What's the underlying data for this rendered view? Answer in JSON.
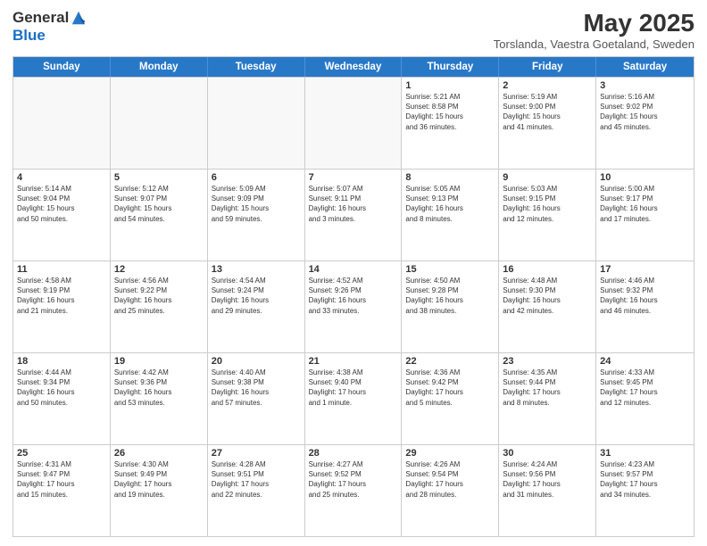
{
  "logo": {
    "general": "General",
    "blue": "Blue"
  },
  "title": "May 2025",
  "subtitle": "Torslanda, Vaestra Goetaland, Sweden",
  "header_days": [
    "Sunday",
    "Monday",
    "Tuesday",
    "Wednesday",
    "Thursday",
    "Friday",
    "Saturday"
  ],
  "weeks": [
    [
      {
        "day": "",
        "info": ""
      },
      {
        "day": "",
        "info": ""
      },
      {
        "day": "",
        "info": ""
      },
      {
        "day": "",
        "info": ""
      },
      {
        "day": "1",
        "info": "Sunrise: 5:21 AM\nSunset: 8:58 PM\nDaylight: 15 hours\nand 36 minutes."
      },
      {
        "day": "2",
        "info": "Sunrise: 5:19 AM\nSunset: 9:00 PM\nDaylight: 15 hours\nand 41 minutes."
      },
      {
        "day": "3",
        "info": "Sunrise: 5:16 AM\nSunset: 9:02 PM\nDaylight: 15 hours\nand 45 minutes."
      }
    ],
    [
      {
        "day": "4",
        "info": "Sunrise: 5:14 AM\nSunset: 9:04 PM\nDaylight: 15 hours\nand 50 minutes."
      },
      {
        "day": "5",
        "info": "Sunrise: 5:12 AM\nSunset: 9:07 PM\nDaylight: 15 hours\nand 54 minutes."
      },
      {
        "day": "6",
        "info": "Sunrise: 5:09 AM\nSunset: 9:09 PM\nDaylight: 15 hours\nand 59 minutes."
      },
      {
        "day": "7",
        "info": "Sunrise: 5:07 AM\nSunset: 9:11 PM\nDaylight: 16 hours\nand 3 minutes."
      },
      {
        "day": "8",
        "info": "Sunrise: 5:05 AM\nSunset: 9:13 PM\nDaylight: 16 hours\nand 8 minutes."
      },
      {
        "day": "9",
        "info": "Sunrise: 5:03 AM\nSunset: 9:15 PM\nDaylight: 16 hours\nand 12 minutes."
      },
      {
        "day": "10",
        "info": "Sunrise: 5:00 AM\nSunset: 9:17 PM\nDaylight: 16 hours\nand 17 minutes."
      }
    ],
    [
      {
        "day": "11",
        "info": "Sunrise: 4:58 AM\nSunset: 9:19 PM\nDaylight: 16 hours\nand 21 minutes."
      },
      {
        "day": "12",
        "info": "Sunrise: 4:56 AM\nSunset: 9:22 PM\nDaylight: 16 hours\nand 25 minutes."
      },
      {
        "day": "13",
        "info": "Sunrise: 4:54 AM\nSunset: 9:24 PM\nDaylight: 16 hours\nand 29 minutes."
      },
      {
        "day": "14",
        "info": "Sunrise: 4:52 AM\nSunset: 9:26 PM\nDaylight: 16 hours\nand 33 minutes."
      },
      {
        "day": "15",
        "info": "Sunrise: 4:50 AM\nSunset: 9:28 PM\nDaylight: 16 hours\nand 38 minutes."
      },
      {
        "day": "16",
        "info": "Sunrise: 4:48 AM\nSunset: 9:30 PM\nDaylight: 16 hours\nand 42 minutes."
      },
      {
        "day": "17",
        "info": "Sunrise: 4:46 AM\nSunset: 9:32 PM\nDaylight: 16 hours\nand 46 minutes."
      }
    ],
    [
      {
        "day": "18",
        "info": "Sunrise: 4:44 AM\nSunset: 9:34 PM\nDaylight: 16 hours\nand 50 minutes."
      },
      {
        "day": "19",
        "info": "Sunrise: 4:42 AM\nSunset: 9:36 PM\nDaylight: 16 hours\nand 53 minutes."
      },
      {
        "day": "20",
        "info": "Sunrise: 4:40 AM\nSunset: 9:38 PM\nDaylight: 16 hours\nand 57 minutes."
      },
      {
        "day": "21",
        "info": "Sunrise: 4:38 AM\nSunset: 9:40 PM\nDaylight: 17 hours\nand 1 minute."
      },
      {
        "day": "22",
        "info": "Sunrise: 4:36 AM\nSunset: 9:42 PM\nDaylight: 17 hours\nand 5 minutes."
      },
      {
        "day": "23",
        "info": "Sunrise: 4:35 AM\nSunset: 9:44 PM\nDaylight: 17 hours\nand 8 minutes."
      },
      {
        "day": "24",
        "info": "Sunrise: 4:33 AM\nSunset: 9:45 PM\nDaylight: 17 hours\nand 12 minutes."
      }
    ],
    [
      {
        "day": "25",
        "info": "Sunrise: 4:31 AM\nSunset: 9:47 PM\nDaylight: 17 hours\nand 15 minutes."
      },
      {
        "day": "26",
        "info": "Sunrise: 4:30 AM\nSunset: 9:49 PM\nDaylight: 17 hours\nand 19 minutes."
      },
      {
        "day": "27",
        "info": "Sunrise: 4:28 AM\nSunset: 9:51 PM\nDaylight: 17 hours\nand 22 minutes."
      },
      {
        "day": "28",
        "info": "Sunrise: 4:27 AM\nSunset: 9:52 PM\nDaylight: 17 hours\nand 25 minutes."
      },
      {
        "day": "29",
        "info": "Sunrise: 4:26 AM\nSunset: 9:54 PM\nDaylight: 17 hours\nand 28 minutes."
      },
      {
        "day": "30",
        "info": "Sunrise: 4:24 AM\nSunset: 9:56 PM\nDaylight: 17 hours\nand 31 minutes."
      },
      {
        "day": "31",
        "info": "Sunrise: 4:23 AM\nSunset: 9:57 PM\nDaylight: 17 hours\nand 34 minutes."
      }
    ]
  ]
}
